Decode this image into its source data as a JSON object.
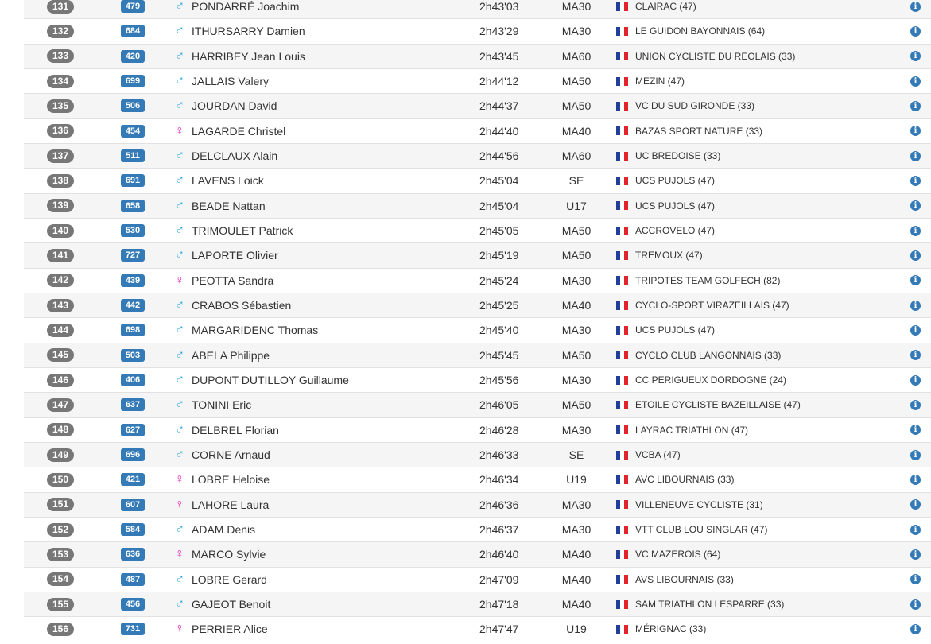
{
  "colors": {
    "rank_badge": "#777777",
    "bib_badge": "#337ab7",
    "male": "#1a9fd9",
    "female": "#e61fb7",
    "info": "#337ab7",
    "flag": [
      "#1f3f9a",
      "#ffffff",
      "#e1242b"
    ]
  },
  "icons": {
    "male": "♂",
    "female": "♀",
    "info": "i",
    "flag": "france-flag-icon"
  },
  "results": [
    {
      "rank": "131",
      "bib": "479",
      "sex": "male",
      "name": "PONDARRÉ Joachim",
      "time": "2h43'03",
      "category": "MA30",
      "club": "CLAIRAC (47)"
    },
    {
      "rank": "132",
      "bib": "684",
      "sex": "male",
      "name": "ITHURSARRY Damien",
      "time": "2h43'29",
      "category": "MA30",
      "club": "LE GUIDON BAYONNAIS (64)"
    },
    {
      "rank": "133",
      "bib": "420",
      "sex": "male",
      "name": "HARRIBEY Jean Louis",
      "time": "2h43'45",
      "category": "MA60",
      "club": "UNION CYCLISTE DU REOLAIS (33)"
    },
    {
      "rank": "134",
      "bib": "699",
      "sex": "male",
      "name": "JALLAIS Valery",
      "time": "2h44'12",
      "category": "MA50",
      "club": "MEZIN (47)"
    },
    {
      "rank": "135",
      "bib": "506",
      "sex": "male",
      "name": "JOURDAN David",
      "time": "2h44'37",
      "category": "MA50",
      "club": "VC DU SUD GIRONDE (33)"
    },
    {
      "rank": "136",
      "bib": "454",
      "sex": "female",
      "name": "LAGARDE Christel",
      "time": "2h44'40",
      "category": "MA40",
      "club": "BAZAS SPORT NATURE (33)"
    },
    {
      "rank": "137",
      "bib": "511",
      "sex": "male",
      "name": "DELCLAUX Alain",
      "time": "2h44'56",
      "category": "MA60",
      "club": "UC BREDOISE (33)"
    },
    {
      "rank": "138",
      "bib": "691",
      "sex": "male",
      "name": "LAVENS Loick",
      "time": "2h45'04",
      "category": "SE",
      "club": "UCS PUJOLS (47)"
    },
    {
      "rank": "139",
      "bib": "658",
      "sex": "male",
      "name": "BEADE Nattan",
      "time": "2h45'04",
      "category": "U17",
      "club": "UCS PUJOLS (47)"
    },
    {
      "rank": "140",
      "bib": "530",
      "sex": "male",
      "name": "TRIMOULET Patrick",
      "time": "2h45'05",
      "category": "MA50",
      "club": "ACCROVELO (47)"
    },
    {
      "rank": "141",
      "bib": "727",
      "sex": "male",
      "name": "LAPORTE Olivier",
      "time": "2h45'19",
      "category": "MA50",
      "club": "TREMOUX (47)"
    },
    {
      "rank": "142",
      "bib": "439",
      "sex": "female",
      "name": "PEOTTA Sandra",
      "time": "2h45'24",
      "category": "MA30",
      "club": "TRIPOTES TEAM GOLFECH (82)"
    },
    {
      "rank": "143",
      "bib": "442",
      "sex": "male",
      "name": "CRABOS Sébastien",
      "time": "2h45'25",
      "category": "MA40",
      "club": "CYCLO-SPORT VIRAZEILLAIS (47)"
    },
    {
      "rank": "144",
      "bib": "698",
      "sex": "male",
      "name": "MARGARIDENC Thomas",
      "time": "2h45'40",
      "category": "MA30",
      "club": "UCS PUJOLS (47)"
    },
    {
      "rank": "145",
      "bib": "503",
      "sex": "male",
      "name": "ABELA Philippe",
      "time": "2h45'45",
      "category": "MA50",
      "club": "CYCLO CLUB LANGONNAIS (33)"
    },
    {
      "rank": "146",
      "bib": "406",
      "sex": "male",
      "name": "DUPONT DUTILLOY Guillaume",
      "time": "2h45'56",
      "category": "MA30",
      "club": "CC PERIGUEUX DORDOGNE (24)"
    },
    {
      "rank": "147",
      "bib": "637",
      "sex": "male",
      "name": "TONINI Eric",
      "time": "2h46'05",
      "category": "MA50",
      "club": "ETOILE CYCLISTE BAZEILLAISE (47)"
    },
    {
      "rank": "148",
      "bib": "627",
      "sex": "male",
      "name": "DELBREL Florian",
      "time": "2h46'28",
      "category": "MA30",
      "club": "LAYRAC TRIATHLON (47)"
    },
    {
      "rank": "149",
      "bib": "696",
      "sex": "male",
      "name": "CORNE Arnaud",
      "time": "2h46'33",
      "category": "SE",
      "club": "VCBA (47)"
    },
    {
      "rank": "150",
      "bib": "421",
      "sex": "female",
      "name": "LOBRE Heloise",
      "time": "2h46'34",
      "category": "U19",
      "club": "AVC LIBOURNAIS (33)"
    },
    {
      "rank": "151",
      "bib": "607",
      "sex": "female",
      "name": "LAHORE Laura",
      "time": "2h46'36",
      "category": "MA30",
      "club": "VILLENEUVE CYCLISTE (31)"
    },
    {
      "rank": "152",
      "bib": "584",
      "sex": "male",
      "name": "ADAM Denis",
      "time": "2h46'37",
      "category": "MA30",
      "club": "VTT CLUB LOU SINGLAR (47)"
    },
    {
      "rank": "153",
      "bib": "636",
      "sex": "female",
      "name": "MARCO Sylvie",
      "time": "2h46'40",
      "category": "MA40",
      "club": "VC MAZEROIS (64)"
    },
    {
      "rank": "154",
      "bib": "487",
      "sex": "male",
      "name": "LOBRE Gerard",
      "time": "2h47'09",
      "category": "MA40",
      "club": "AVS LIBOURNAIS (33)"
    },
    {
      "rank": "155",
      "bib": "456",
      "sex": "male",
      "name": "GAJEOT Benoit",
      "time": "2h47'18",
      "category": "MA40",
      "club": "SAM TRIATHLON LESPARRE (33)"
    },
    {
      "rank": "156",
      "bib": "731",
      "sex": "female",
      "name": "PERRIER Alice",
      "time": "2h47'47",
      "category": "U19",
      "club": "MÉRIGNAC (33)"
    }
  ]
}
